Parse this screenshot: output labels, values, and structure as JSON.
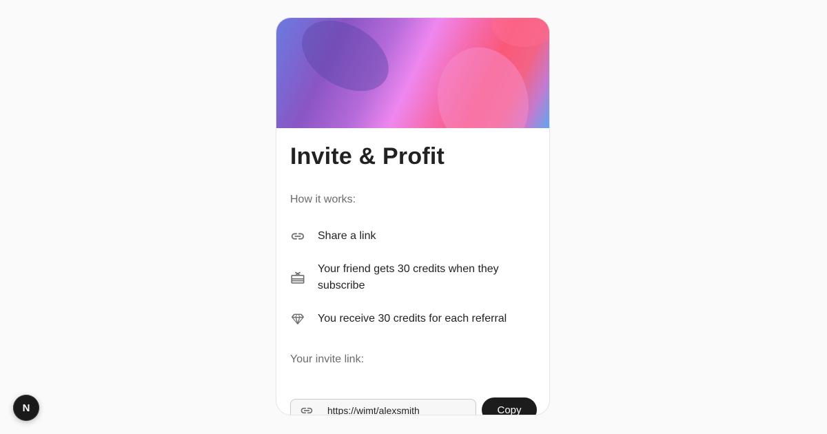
{
  "card": {
    "title": "Invite & Profit",
    "how_label": "How it works:",
    "steps": [
      {
        "icon": "link-icon",
        "text": "Share a link"
      },
      {
        "icon": "gift-icon",
        "text": "Your friend gets 30 credits when they subscribe"
      },
      {
        "icon": "diamond-icon",
        "text": "You receive 30 credits for each referral"
      }
    ],
    "invite_label": "Your invite link:",
    "invite_link": "https://wimt/alexsmith",
    "copy_label": "Copy"
  },
  "dev_badge": {
    "icon": "nextjs-logo-icon",
    "letter": "N"
  },
  "colors": {
    "button_bg": "#1c1c1c",
    "hero_gradient": [
      "#6a7be0",
      "#ee87ef",
      "#fa5878",
      "#5aaaf0"
    ]
  }
}
